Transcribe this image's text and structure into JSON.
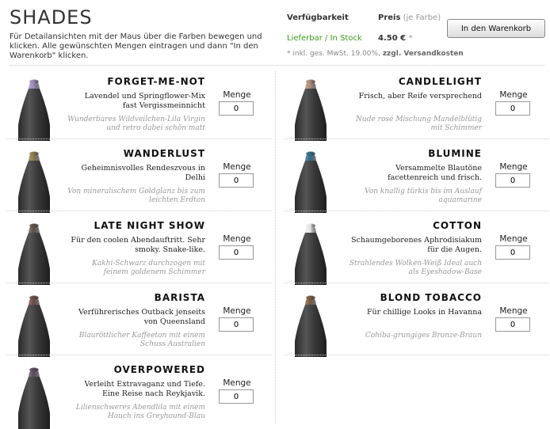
{
  "header": {
    "title": "SHADES",
    "intro": "Für Detailansichten mit der Maus über die Farben bewegen und klicken. Alle gewünschten Mengen eintragen und dann \"In den Warenkorb\" klicken.",
    "availability_label": "Verfügbarkeit",
    "price_label": "Preis",
    "price_sub": "(je Farbe)",
    "status": "Lieferbar / In Stock",
    "price": "4.50 €",
    "price_star": "*",
    "cart_button": "In den Warenkorb",
    "note_prefix": "* inkl. ges. MwSt. 19.00%,",
    "note_link": "zzgl. Versandkosten"
  },
  "colors": {
    "status_green": "#3a9a1e",
    "pencil_body": "#3b3b3b"
  },
  "shades": [
    {
      "name": "FORGET-ME-NOT",
      "desc": "Lavendel und Springflower-Mix fast Vergissmeinnicht",
      "sub": "Wunderbares Wildveilchen-Lila Virgin und retro dabei schön matt",
      "menge": "Menge",
      "qty": "0",
      "tip": "#9a8ab8"
    },
    {
      "name": "CANDLELIGHT",
      "desc": "Frisch, aber Reife versprechend",
      "sub": "Nude rosé Mischung Mandelblütig mit Schimmer",
      "menge": "Menge",
      "qty": "0",
      "tip": "#b08a78"
    },
    {
      "name": "WANDERLUST",
      "desc": "Geheimnisvolles Rendeszvous in Delhi",
      "sub": "Von mineralischem Goldglanz bis zum leichten Erdton",
      "menge": "Menge",
      "qty": "0",
      "tip": "#8a7a48"
    },
    {
      "name": "BLUMINE",
      "desc": "Versammelte Blautöne facettenreich und frisch.",
      "sub": "Von knallig türkis bis im Auslauf aquamarine",
      "menge": "Menge",
      "qty": "0",
      "tip": "#2f6a86"
    },
    {
      "name": "LATE NIGHT SHOW",
      "desc": "Für den coolen Abendauftritt. Sehr smoky. Snake-like.",
      "sub": "Kakhi-Schwarz durchzogen mit feinem goldenem Schimmer",
      "menge": "Menge",
      "qty": "0",
      "tip": "#5a5246"
    },
    {
      "name": "COTTON",
      "desc": "Schaumgeborenes Aphrodisiakum für die Augen.",
      "sub": "Strahlendes Wolken-Weiß Ideal auch als Eyeshadow-Base",
      "menge": "Menge",
      "qty": "0",
      "tip": "#e8e8e8"
    },
    {
      "name": "BARISTA",
      "desc": "Verführerisches Outback jenseits von Queensland",
      "sub": "Blauröttlicher Kaffeeton mit einem Schuss Australien",
      "menge": "Menge",
      "qty": "0",
      "tip": "#6a4a44"
    },
    {
      "name": "BLOND TOBACCO",
      "desc": "Für chillige Looks in Havanna",
      "sub": "Cohiba-grungiges Bronze-Braun",
      "menge": "Menge",
      "qty": "0",
      "tip": "#7a5a3e"
    },
    {
      "name": "OVERPOWERED",
      "desc": "Verleiht Extravaganz und Tiefe. Eine Reise nach Reykjavik.",
      "sub": "Lilienschweres Abendlila mit einem Hauch ins Greyhound-Blau",
      "menge": "Menge",
      "qty": "0",
      "tip": "#5a4a5e"
    }
  ]
}
